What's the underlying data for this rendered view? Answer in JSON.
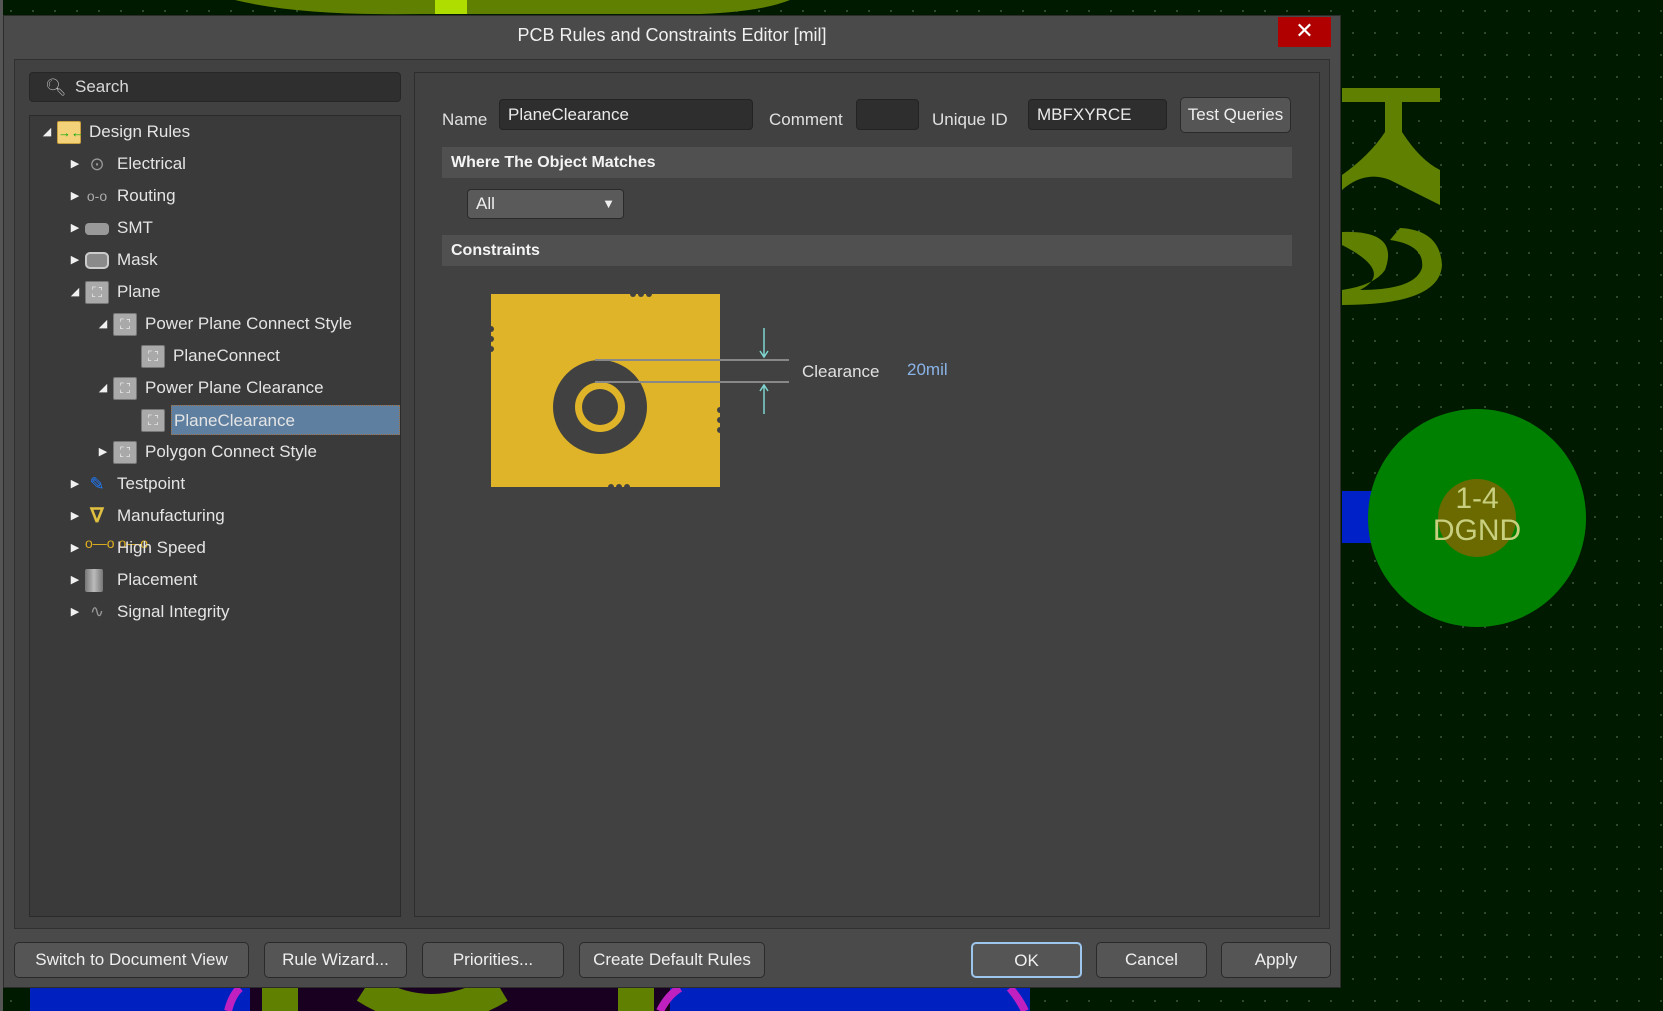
{
  "dialog": {
    "title": "PCB Rules and Constraints Editor [mil]",
    "close_icon": "close-icon"
  },
  "search": {
    "placeholder": "Search"
  },
  "tree": [
    {
      "label": "Design Rules",
      "level": 0,
      "expander": "expanded",
      "icon": "design-rules-folder-icon"
    },
    {
      "label": "Electrical",
      "level": 1,
      "expander": "collapsed",
      "icon": "electrical-icon"
    },
    {
      "label": "Routing",
      "level": 1,
      "expander": "collapsed",
      "icon": "routing-icon"
    },
    {
      "label": "SMT",
      "level": 1,
      "expander": "collapsed",
      "icon": "smt-icon"
    },
    {
      "label": "Mask",
      "level": 1,
      "expander": "collapsed",
      "icon": "mask-icon"
    },
    {
      "label": "Plane",
      "level": 1,
      "expander": "expanded",
      "icon": "plane-icon"
    },
    {
      "label": "Power Plane Connect Style",
      "level": 2,
      "expander": "expanded",
      "icon": "plane-icon"
    },
    {
      "label": "PlaneConnect",
      "level": 3,
      "expander": "none",
      "icon": "plane-icon"
    },
    {
      "label": "Power Plane Clearance",
      "level": 2,
      "expander": "expanded",
      "icon": "plane-icon"
    },
    {
      "label": "PlaneClearance",
      "level": 3,
      "expander": "none",
      "icon": "plane-icon",
      "selected": true
    },
    {
      "label": "Polygon Connect Style",
      "level": 2,
      "expander": "collapsed",
      "icon": "plane-icon"
    },
    {
      "label": "Testpoint",
      "level": 1,
      "expander": "collapsed",
      "icon": "testpoint-icon"
    },
    {
      "label": "Manufacturing",
      "level": 1,
      "expander": "collapsed",
      "icon": "manufacturing-icon"
    },
    {
      "label": "High Speed",
      "level": 1,
      "expander": "collapsed",
      "icon": "high-speed-icon"
    },
    {
      "label": "Placement",
      "level": 1,
      "expander": "collapsed",
      "icon": "placement-icon"
    },
    {
      "label": "Signal Integrity",
      "level": 1,
      "expander": "collapsed",
      "icon": "signal-integrity-icon"
    }
  ],
  "rule": {
    "name_label": "Name",
    "name_value": "PlaneClearance",
    "comment_label": "Comment",
    "comment_value": "",
    "uid_label": "Unique ID",
    "uid_value": "MBFXYRCE",
    "test_queries": "Test Queries",
    "where_header": "Where The Object Matches",
    "match_select": "All",
    "constraints_header": "Constraints",
    "clearance_label": "Clearance",
    "clearance_value": "20mil"
  },
  "buttons": {
    "switch_view": "Switch to Document View",
    "rule_wizard": "Rule Wizard...",
    "priorities": "Priorities...",
    "create_defaults": "Create Default Rules",
    "ok": "OK",
    "cancel": "Cancel",
    "apply": "Apply"
  },
  "pcb": {
    "pad_label_1": "1-4",
    "pad_label_2": "DGND"
  },
  "colors": {
    "plane_copper": "#dfb428",
    "clearance_value": "#8ab4e8",
    "selection": "#5f7fa0",
    "close": "#b00000"
  }
}
